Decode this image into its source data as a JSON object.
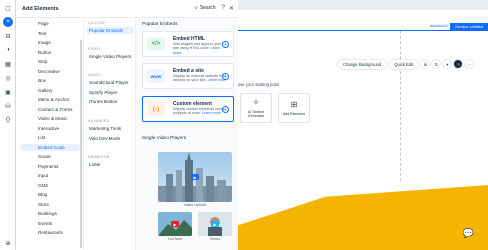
{
  "panel": {
    "title": "Add Elements",
    "search_label": "Search",
    "categories": [
      "Page",
      "Text",
      "Image",
      "Button",
      "Strip",
      "Decorative",
      "Box",
      "Gallery",
      "Menu & Anchor",
      "Contact & Forms",
      "Video & Music",
      "Interactive",
      "List",
      "Embed Code",
      "Social",
      "Payments",
      "Input",
      "CMS",
      "Blog",
      "Store",
      "Bookings",
      "Events",
      "Restaurants"
    ],
    "selected_category": "Embed Code",
    "sub_groups": [
      {
        "head": "CUSTOM",
        "items": [
          "Popular Embeds"
        ]
      },
      {
        "head": "VIDEO",
        "items": [
          "Single Video Players"
        ]
      },
      {
        "head": "AUDIO",
        "items": [
          "SoundCloud Player",
          "Spotify Player",
          "iTunes Button"
        ]
      },
      {
        "head": "ADVANCED",
        "items": [
          "Marketing Tools",
          "Velo Dev Mode"
        ]
      },
      {
        "head": "ANIMATION",
        "items": [
          "Lottie"
        ]
      }
    ],
    "popular_title": "Popular Embeds",
    "cards": [
      {
        "title": "Embed HTML",
        "desc": "Add widgets and apps to your site using HTML code.",
        "link": "Learn more",
        "icon": "code-icon"
      },
      {
        "title": "Embed a site",
        "desc": "Display an external website in a window on your site.",
        "link": "Learn more",
        "icon": "www-icon"
      },
      {
        "title": "Custom element",
        "desc": "Display custom elements using snippets of code.",
        "link": "Learn more",
        "icon": "custom-code-icon"
      }
    ],
    "video_title": "Single Video Players",
    "video_caption": "Video Upload",
    "video_small": [
      "YouTube",
      "Vimeo"
    ]
  },
  "canvas": {
    "section_id": "#section11",
    "section_label": "Section: Untitled",
    "change_background": "Change Background",
    "quick_edit": "Quick Edit",
    "hint": "ose your starting point",
    "tiles": [
      {
        "label": "AI Section Generator",
        "icon": "sparkle-icon"
      },
      {
        "label": "Add Elements",
        "icon": "plus-square-icon"
      }
    ]
  },
  "colors": {
    "accent": "#116dff",
    "yellow": "#f5b400"
  }
}
